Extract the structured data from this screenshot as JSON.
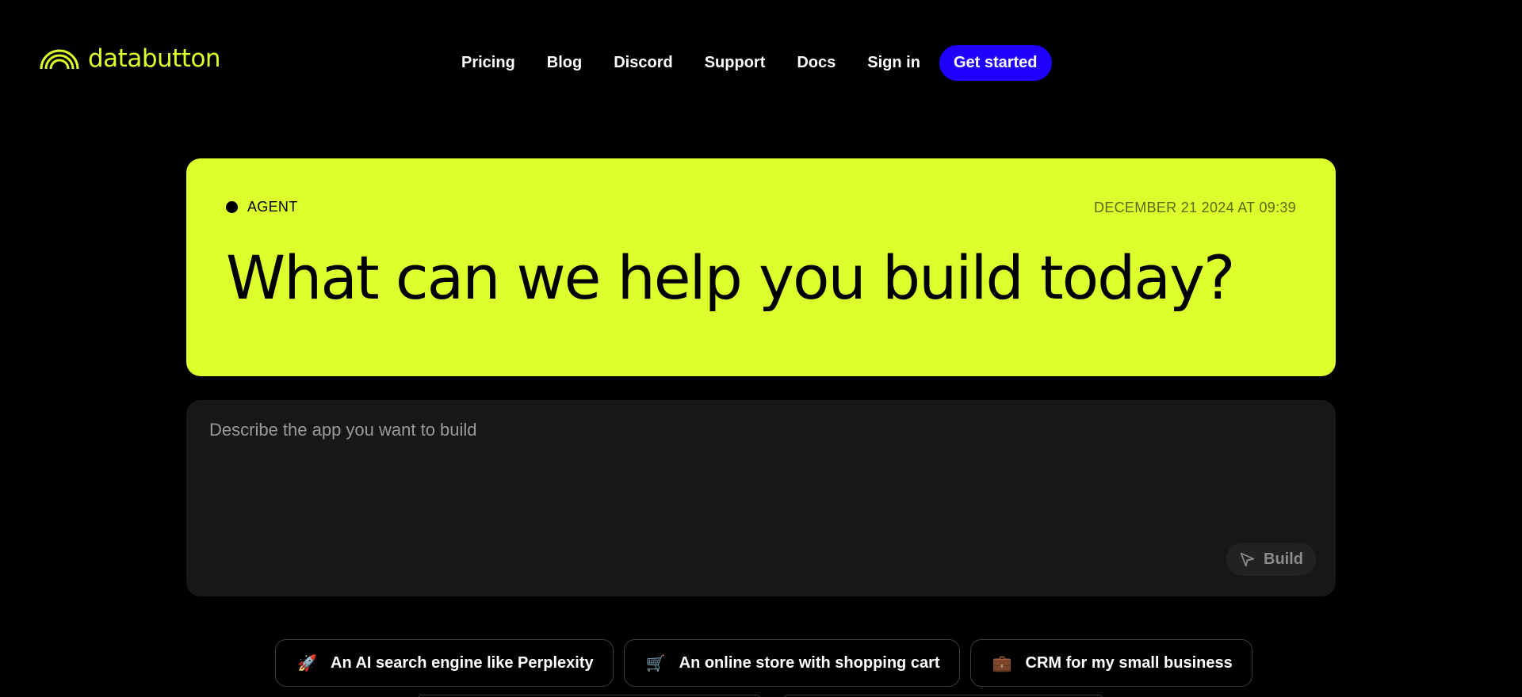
{
  "header": {
    "logo_text": "databutton",
    "nav": [
      {
        "label": "Pricing"
      },
      {
        "label": "Blog"
      },
      {
        "label": "Discord"
      },
      {
        "label": "Support"
      },
      {
        "label": "Docs"
      },
      {
        "label": "Sign in"
      }
    ],
    "cta_label": "Get started"
  },
  "hero": {
    "tag": "AGENT",
    "date": "DECEMBER 21 2024 AT 09:39",
    "title": "What can we help you build today?"
  },
  "prompt": {
    "placeholder": "Describe the app you want to build",
    "value": "",
    "build_label": "Build"
  },
  "suggestions": [
    {
      "icon": "rocket-icon",
      "glyph": "🚀",
      "label": "An AI search engine like Perplexity"
    },
    {
      "icon": "shopping-cart-icon",
      "glyph": "🛒",
      "label": "An online store with shopping cart"
    },
    {
      "icon": "briefcase-icon",
      "glyph": "💼",
      "label": "CRM for my small business"
    }
  ],
  "colors": {
    "background": "#000000",
    "brand_lime": "#dcff2e",
    "cta_blue": "#1f00ff",
    "panel": "#171717"
  }
}
